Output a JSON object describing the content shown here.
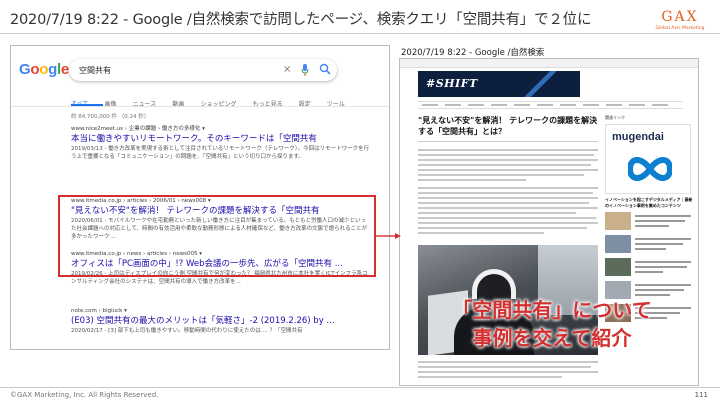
{
  "slide": {
    "title": "2020/7/19 8:22 - Google /自然検索で訪問したページ、検索クエリ「空間共有」で２位に",
    "logo_word": "GAX",
    "logo_sub": "Global Axis Marketing",
    "caption": "「空間共有」について\n事例を交えて紹介",
    "copyright": "©GAX Marketing, Inc. All Rights Reserved.",
    "page_number": "111",
    "accent_color": "#d32f2f"
  },
  "serp": {
    "logo_letters": [
      "G",
      "o",
      "o",
      "g",
      "l",
      "e"
    ],
    "query": "空間共有",
    "tabs": [
      {
        "label": "すべて",
        "active": true
      },
      {
        "label": "画像",
        "active": false
      },
      {
        "label": "ニュース",
        "active": false
      },
      {
        "label": "動画",
        "active": false
      },
      {
        "label": "ショッピング",
        "active": false
      },
      {
        "label": "もっと見る",
        "active": false
      },
      {
        "label": "設定",
        "active": false
      },
      {
        "label": "ツール",
        "active": false
      }
    ],
    "stats": "約 84,700,000 件 （0.24 秒）",
    "results": [
      {
        "url": "www.nice2meet.us › 企業の課題 › 働き方の多様化 ▾",
        "title": "本当に働きやすいリモートワーク。そのキーワードは「空間共有",
        "snippet": "2019/03/13 - 働き方改革を実現する術として注目されているリモートワーク（テレワーク）。今回はリモートワークを行う上で重要となる「コミュニケーション」の問題を、「空間共有」という切り口から探ります。"
      },
      {
        "url": "www.itmedia.co.jp › articles › 2006/01 › news008 ▾",
        "title": "\"見えない不安\"を解消！ テレワークの課題を解決する「空間共有",
        "snippet": "2020/06/01 - モバイルワークや在宅勤務といった新しい働き方に注目が集まっている。もともと労働人口の減少といった社会課題への対応として、時間の有効活用や柔軟な勤務形態による人材確保など、働き方改革の文脈で語られることが多かったワーク ..."
      },
      {
        "url": "www.itmedia.co.jp › news › articles › news005 ▾",
        "title": "オフィスは「PC画面の中」!? Web会議の一歩先、広がる「空間共有 ...",
        "snippet": "2019/02/26 - 上司はディスプレイの向こう側 空間共有で何が変わった？ 福岡県北九州市に本社を置くICTインフラ系コンサルティング会社のシステナは、空間共有の導入で働き方改革を..."
      },
      {
        "url": "note.com › bigluck ▾",
        "title": "(E03) 空間共有の最大のメリットは「気軽さ」-2 (2019.2.26) by ...",
        "snippet": "2020/02/17 - [3] 部下も上司も働きやすい。移動時間の代わりに使えたのは.... ？「空間共有"
      }
    ]
  },
  "article": {
    "caption": "2020/7/19 8:22 - Google /自然検索",
    "banner_text": "#SHIFT",
    "headline": "\"見えない不安\"を解消！ テレワークの課題を解決する「空間共有」とは？",
    "sidebar_label": "関連リンク",
    "sidebar_brand": "mugendai",
    "sidebar_text": "イノベーションを起こすデジタルメディア｜最新のイノベーション事例を集めたコンテンツ"
  }
}
